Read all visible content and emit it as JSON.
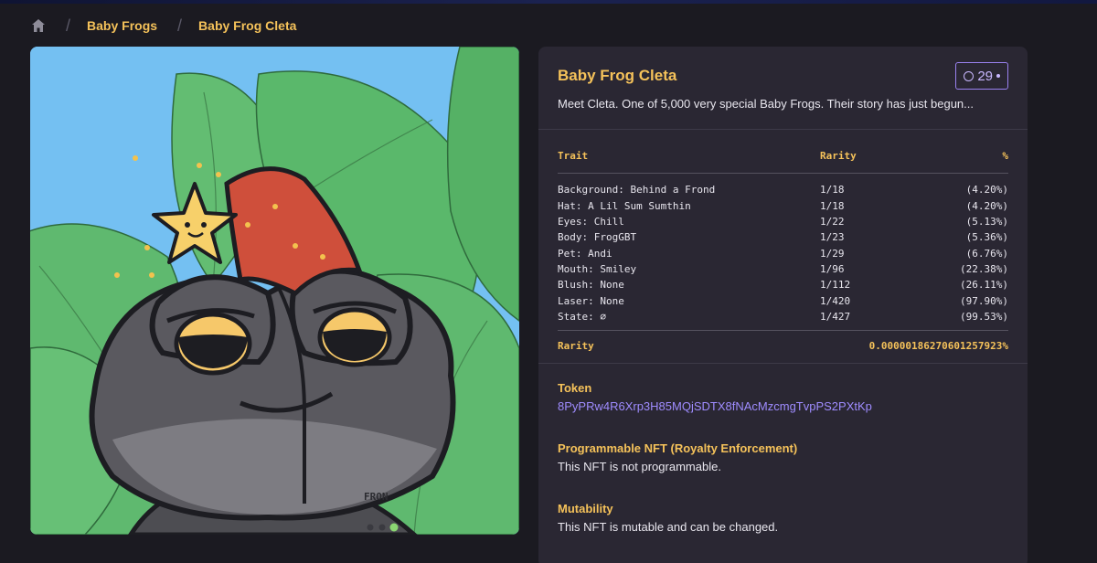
{
  "breadcrumb": {
    "home_icon": "home-icon",
    "items": [
      "Baby Frogs",
      "Baby Frog Cleta"
    ]
  },
  "artwork": {
    "signature": "FRON"
  },
  "details": {
    "title": "Baby Frog Cleta",
    "badge_count": "29",
    "description": "Meet Cleta. One of 5,000 very special Baby Frogs. Their story has just begun...",
    "traits_table": {
      "headers": [
        "Trait",
        "Rarity",
        "%"
      ],
      "rows": [
        {
          "trait": "Background: Behind a Frond",
          "rarity": "1/18",
          "pct": "(4.20%)"
        },
        {
          "trait": "Hat: A Lil Sum Sumthin",
          "rarity": "1/18",
          "pct": "(4.20%)"
        },
        {
          "trait": "Eyes: Chill",
          "rarity": "1/22",
          "pct": "(5.13%)"
        },
        {
          "trait": "Body: FrogGBT",
          "rarity": "1/23",
          "pct": "(5.36%)"
        },
        {
          "trait": "Pet: Andi",
          "rarity": "1/29",
          "pct": "(6.76%)"
        },
        {
          "trait": "Mouth: Smiley",
          "rarity": "1/96",
          "pct": "(22.38%)"
        },
        {
          "trait": "Blush: None",
          "rarity": "1/112",
          "pct": "(26.11%)"
        },
        {
          "trait": "Laser: None",
          "rarity": "1/420",
          "pct": "(97.90%)"
        },
        {
          "trait": "State: ∅",
          "rarity": "1/427",
          "pct": "(99.53%)"
        }
      ],
      "total_label": "Rarity",
      "total_value": "0.00000186270601257923%"
    },
    "token": {
      "label": "Token",
      "value": "8PyPRw4R6Xrp3H85MQjSDTX8fNAcMzcmgTvpPS2PXtKp"
    },
    "programmable": {
      "label": "Programmable NFT (Royalty Enforcement)",
      "value": "This NFT is not programmable."
    },
    "mutability": {
      "label": "Mutability",
      "value": "This NFT is mutable and can be changed."
    }
  },
  "colors": {
    "accent": "#f5c25a",
    "link": "#9f8cff",
    "panel": "#2a2733",
    "background": "#1b1a21"
  }
}
